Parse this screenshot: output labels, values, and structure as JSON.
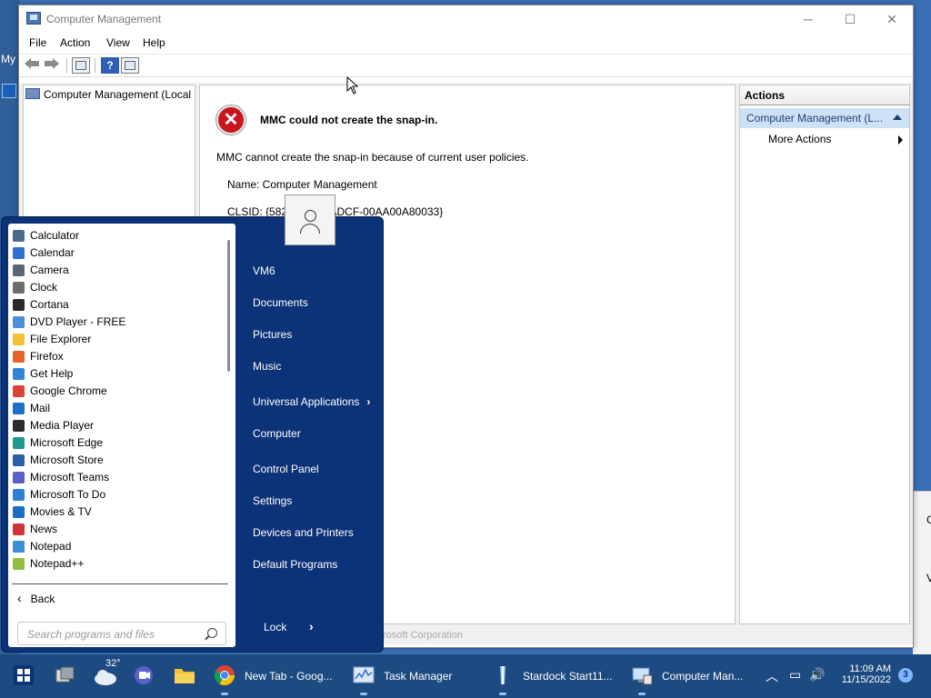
{
  "desktop": {
    "label_fragment": "My"
  },
  "window": {
    "title": "Computer Management",
    "controls": {
      "minimize": "─",
      "maximize": "☐",
      "close": "✕"
    }
  },
  "menu": [
    "File",
    "Action",
    "View",
    "Help"
  ],
  "toolbar": {
    "back_icon": "arrow-left-icon",
    "forward_icon": "arrow-right-icon",
    "help_label": "?"
  },
  "tree": {
    "root_label": "Computer Management (Local"
  },
  "error": {
    "title": "MMC could not create the snap-in.",
    "description": "MMC cannot create the snap-in because of current user policies.",
    "name_line": "Name: Computer Management",
    "clsid_line": "CLSID: {5822                  -11CF-ADCF-00AA00A80033}",
    "icon_glyph": "✕"
  },
  "actions": {
    "header": "Actions",
    "group_label": "Computer Management (L...",
    "more_actions": "More Actions"
  },
  "statusbar": {
    "partial_text": "rosoft Corporation"
  },
  "right_window_fragments": [
    "C",
    "V"
  ],
  "start_menu": {
    "programs": [
      {
        "label": "Calculator",
        "color": "#4a6b8f"
      },
      {
        "label": "Calendar",
        "color": "#2f6fd0"
      },
      {
        "label": "Camera",
        "color": "#5a6573"
      },
      {
        "label": "Clock",
        "color": "#6d6d6d"
      },
      {
        "label": "Cortana",
        "color": "#2a2a2a"
      },
      {
        "label": "DVD Player - FREE",
        "color": "#4c8fd6"
      },
      {
        "label": "File Explorer",
        "color": "#f2c230"
      },
      {
        "label": "Firefox",
        "color": "#e8622a"
      },
      {
        "label": "Get Help",
        "color": "#2f86d8"
      },
      {
        "label": "Google Chrome",
        "color": "#db4437"
      },
      {
        "label": "Mail",
        "color": "#1f6fc9"
      },
      {
        "label": "Media Player",
        "color": "#2b2b2b"
      },
      {
        "label": "Microsoft Edge",
        "color": "#1f9a8f"
      },
      {
        "label": "Microsoft Store",
        "color": "#2a5fa8"
      },
      {
        "label": "Microsoft Teams",
        "color": "#5b5fc7"
      },
      {
        "label": "Microsoft To Do",
        "color": "#2e7fd6"
      },
      {
        "label": "Movies & TV",
        "color": "#1d6fc0"
      },
      {
        "label": "News",
        "color": "#d13438"
      },
      {
        "label": "Notepad",
        "color": "#3a8fd8"
      },
      {
        "label": "Notepad++",
        "color": "#8fbf3c"
      }
    ],
    "back_label": "Back",
    "search_placeholder": "Search programs and files",
    "links": [
      {
        "label": "VM6"
      },
      {
        "label": "Documents"
      },
      {
        "label": "Pictures"
      },
      {
        "label": "Music"
      },
      {
        "label": "Universal Applications",
        "chevron": "›"
      },
      {
        "label": "Computer"
      },
      {
        "label": "Control Panel"
      },
      {
        "label": "Settings"
      },
      {
        "label": "Devices and Printers"
      },
      {
        "label": "Default Programs"
      }
    ],
    "lock_label": "Lock",
    "lock_arrow": "›"
  },
  "taskbar": {
    "weather_temp": "32°",
    "apps": [
      {
        "label": "New Tab - Goog...",
        "icon": "chrome-icon"
      },
      {
        "label": "Task Manager",
        "icon": "task-manager-icon"
      },
      {
        "label": "Stardock Start11...",
        "icon": "stardock-icon"
      },
      {
        "label": "Computer Man...",
        "icon": "computer-management-icon"
      }
    ],
    "tray": {
      "chevron": "︿",
      "network": "▭",
      "volume": "🔊"
    },
    "clock": {
      "time": "11:09 AM",
      "date": "11/15/2022"
    },
    "notifications": "3",
    "colors": {
      "taskbar": "#1d4a80",
      "start_menu": "#0c3277",
      "accent": "#cde2f7"
    }
  }
}
